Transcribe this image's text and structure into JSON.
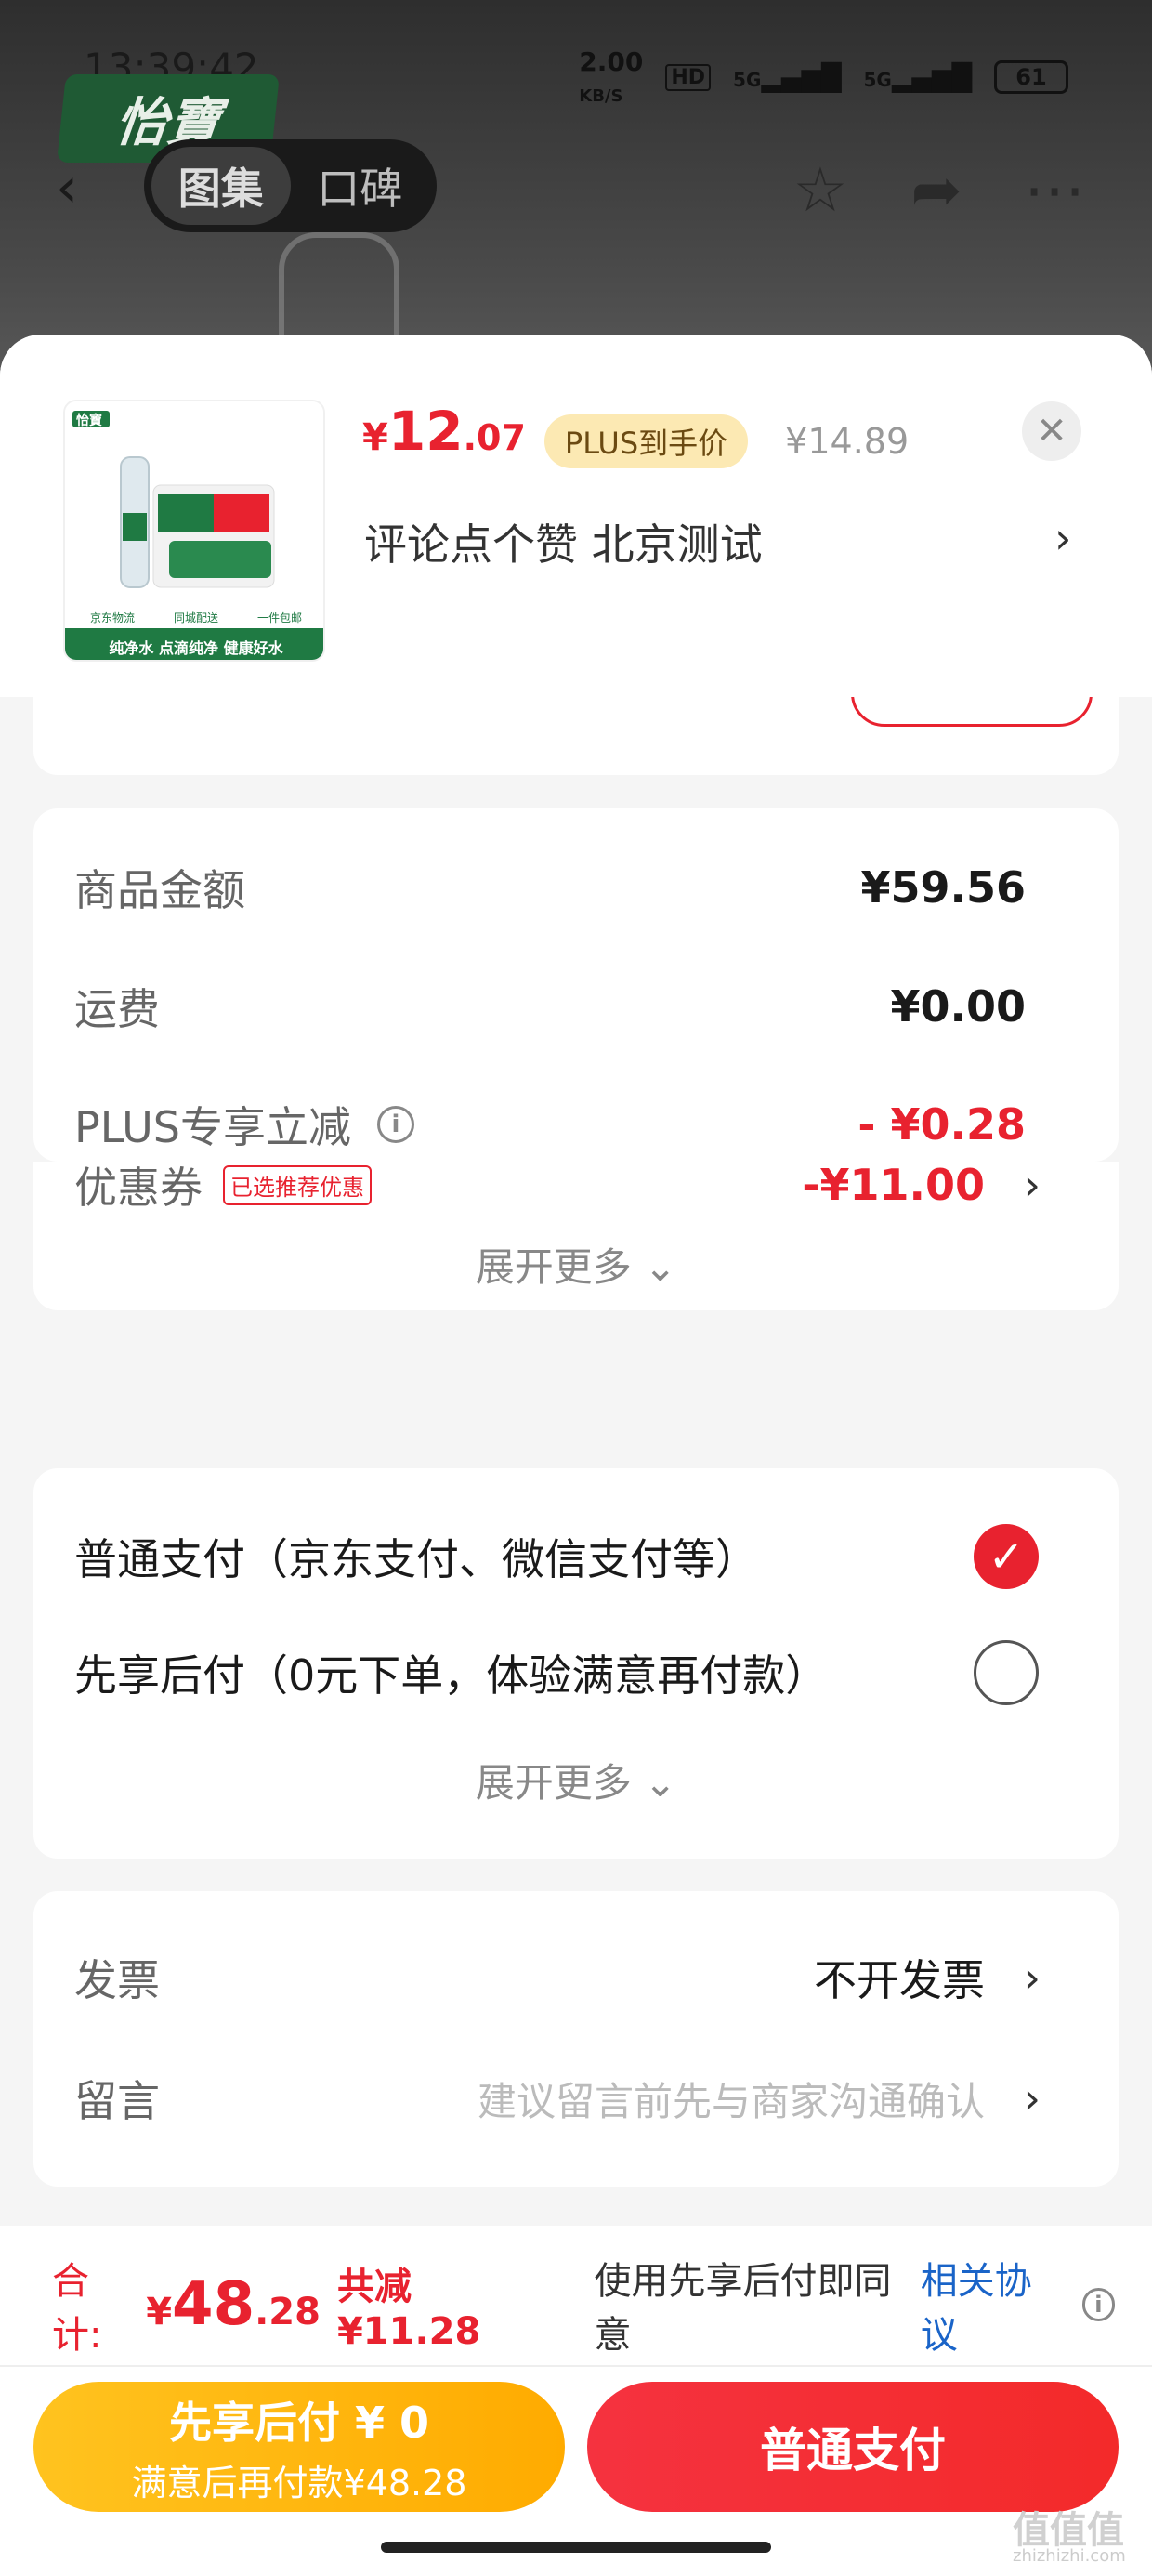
{
  "status_bar": {
    "time": "13:39:42",
    "net_speed": "2.00",
    "net_unit": "KB/S",
    "hd": "HD",
    "sig1": "5G",
    "sig2": "5G",
    "battery": "61"
  },
  "background": {
    "brand_logo": "怡寶",
    "tabs": [
      {
        "label": "图集",
        "active": true
      },
      {
        "label": "口碑",
        "active": false
      }
    ],
    "icons": [
      "back-icon",
      "star-icon",
      "share-icon",
      "more-icon"
    ]
  },
  "product": {
    "thumb_brand": "怡寶",
    "thumb_tags": [
      "京东物流",
      "同城配送",
      "一件包邮"
    ],
    "thumb_slogan": "纯净水 点滴纯净 健康好水",
    "price_yen": "¥",
    "price_int": "12",
    "price_dec": ".07",
    "plus_badge": "PLUS到手价",
    "orig_price": "¥14.89",
    "spec": "评论点个赞  北京测试",
    "close_icon": "close-icon"
  },
  "cost_card": {
    "rows": [
      {
        "label": "商品金额",
        "value": "¥59.56"
      },
      {
        "label": "运费",
        "value": "¥0.00"
      },
      {
        "label": "PLUS专享立减",
        "value": "- ¥0.28"
      },
      {
        "label": "优惠券",
        "tag": "已选推荐优惠",
        "value": "-¥11.00"
      }
    ],
    "expand": "展开更多"
  },
  "payment_card": {
    "options": [
      {
        "label": "普通支付（京东支付、微信支付等）",
        "selected": true
      },
      {
        "label": "先享后付（0元下单，体验满意再付款）",
        "selected": false
      }
    ],
    "expand": "展开更多"
  },
  "extra_card": {
    "invoice_label": "发票",
    "invoice_value": "不开发票",
    "message_label": "留言",
    "message_placeholder": "建议留言前先与商家沟通确认"
  },
  "bottom_bar": {
    "total_label": "合计:",
    "total_yen": "¥",
    "total_int": "48",
    "total_dec": ".28",
    "discount": "共减¥11.28",
    "agree_text": "使用先享后付即同意",
    "agree_link": "相关协议",
    "btn_later_line1": "先享后付 ¥ 0",
    "btn_later_line2": "满意后再付款¥48.28",
    "btn_normal": "普通支付",
    "watermark": "值值值",
    "watermark_sub": "zhizhizhi.com"
  },
  "colors": {
    "accent_red": "#e8222f",
    "plus_gold": "#fce9b3",
    "later_yellow": "#ffc31f",
    "link_blue": "#1a64c8"
  }
}
